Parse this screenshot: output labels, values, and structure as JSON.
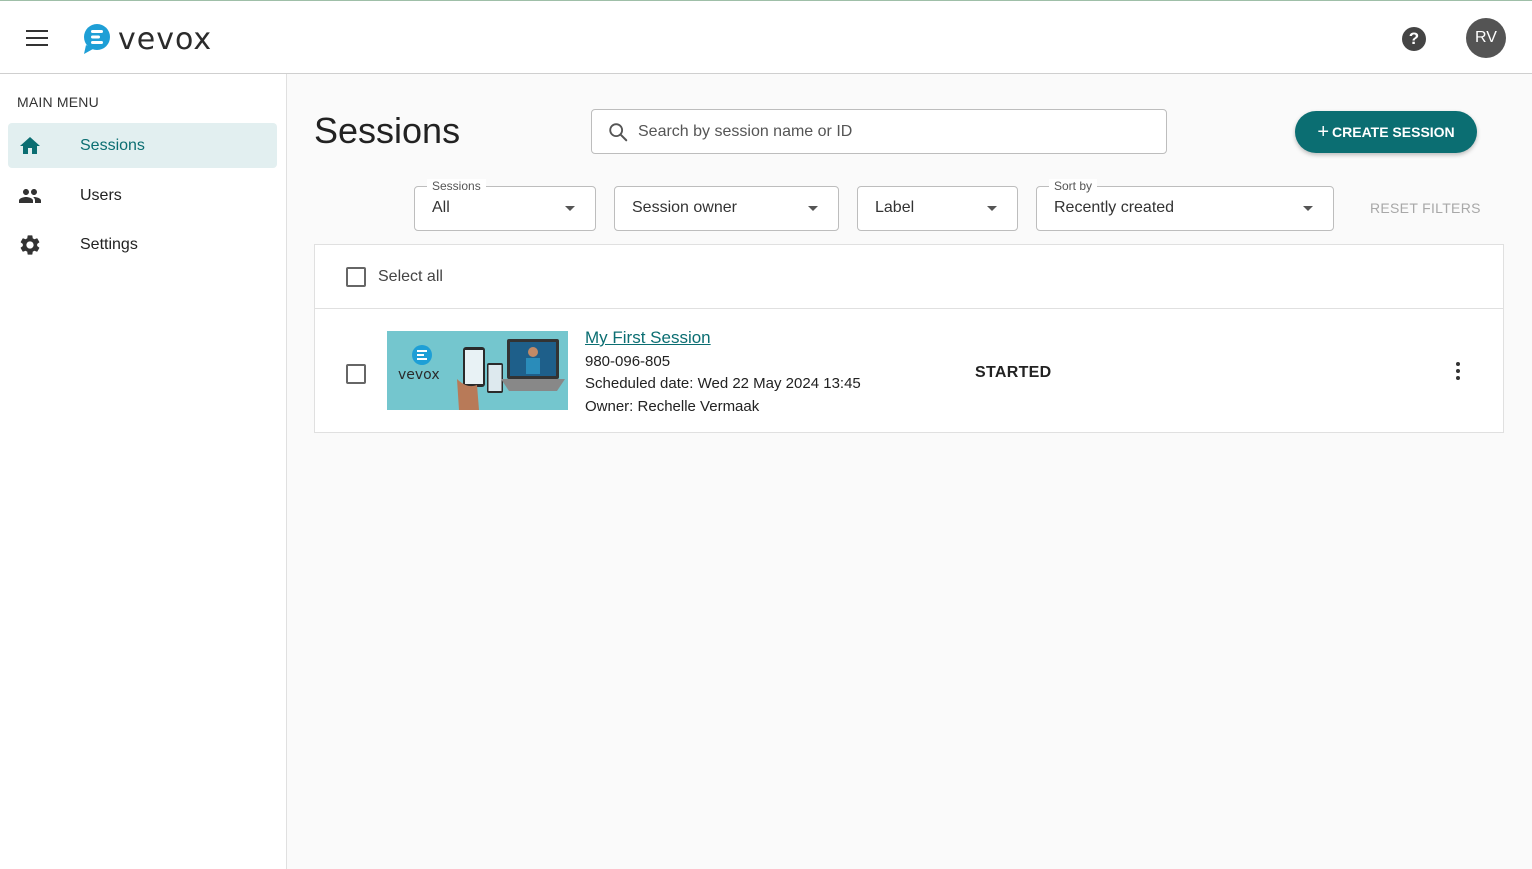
{
  "header": {
    "logo_text": "vevox",
    "help_symbol": "?",
    "avatar_initials": "RV",
    "accent_color": "#0b6e72"
  },
  "sidebar": {
    "heading": "MAIN MENU",
    "items": [
      {
        "label": "Sessions",
        "icon": "home-icon",
        "active": true
      },
      {
        "label": "Users",
        "icon": "people-icon",
        "active": false
      },
      {
        "label": "Settings",
        "icon": "gear-icon",
        "active": false
      }
    ]
  },
  "main": {
    "title": "Sessions",
    "search": {
      "placeholder": "Search by session name or ID",
      "value": ""
    },
    "create_button": {
      "plus": "+",
      "label": "CREATE SESSION"
    },
    "filters": {
      "sessions": {
        "legend": "Sessions",
        "value": "All"
      },
      "owner": {
        "value": "Session owner"
      },
      "label": {
        "value": "Label"
      },
      "sort": {
        "legend": "Sort by",
        "value": "Recently created"
      },
      "reset_label": "RESET FILTERS"
    },
    "list": {
      "select_all_label": "Select all",
      "sessions": [
        {
          "title": "My First Session",
          "id": "980-096-805",
          "scheduled": "Scheduled date: Wed 22 May 2024 13:45",
          "owner": "Owner: Rechelle Vermaak",
          "status": "STARTED",
          "thumbnail_brand": "vevox"
        }
      ]
    }
  }
}
